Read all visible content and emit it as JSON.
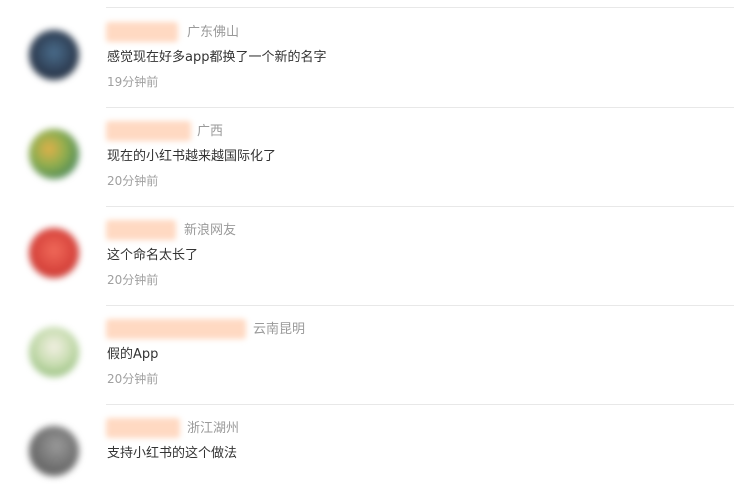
{
  "comments": [
    {
      "location": "广东佛山",
      "text": "感觉现在好多app都换了一个新的名字",
      "time": "19分钟前",
      "avatar_color": "#2f3f55"
    },
    {
      "location": "广西",
      "text": "现在的小红书越来越国际化了",
      "time": "20分钟前",
      "avatar_color": "#7fa04a"
    },
    {
      "location": "新浪网友",
      "text": "这个命名太长了",
      "time": "20分钟前",
      "avatar_color": "#d8453d"
    },
    {
      "location": "云南昆明",
      "text": "假的App",
      "time": "20分钟前",
      "avatar_color": "#a9c98f"
    },
    {
      "location": "浙江湖州",
      "text": "支持小红书的这个做法",
      "time": "",
      "avatar_color": "#7d7d7d"
    }
  ]
}
